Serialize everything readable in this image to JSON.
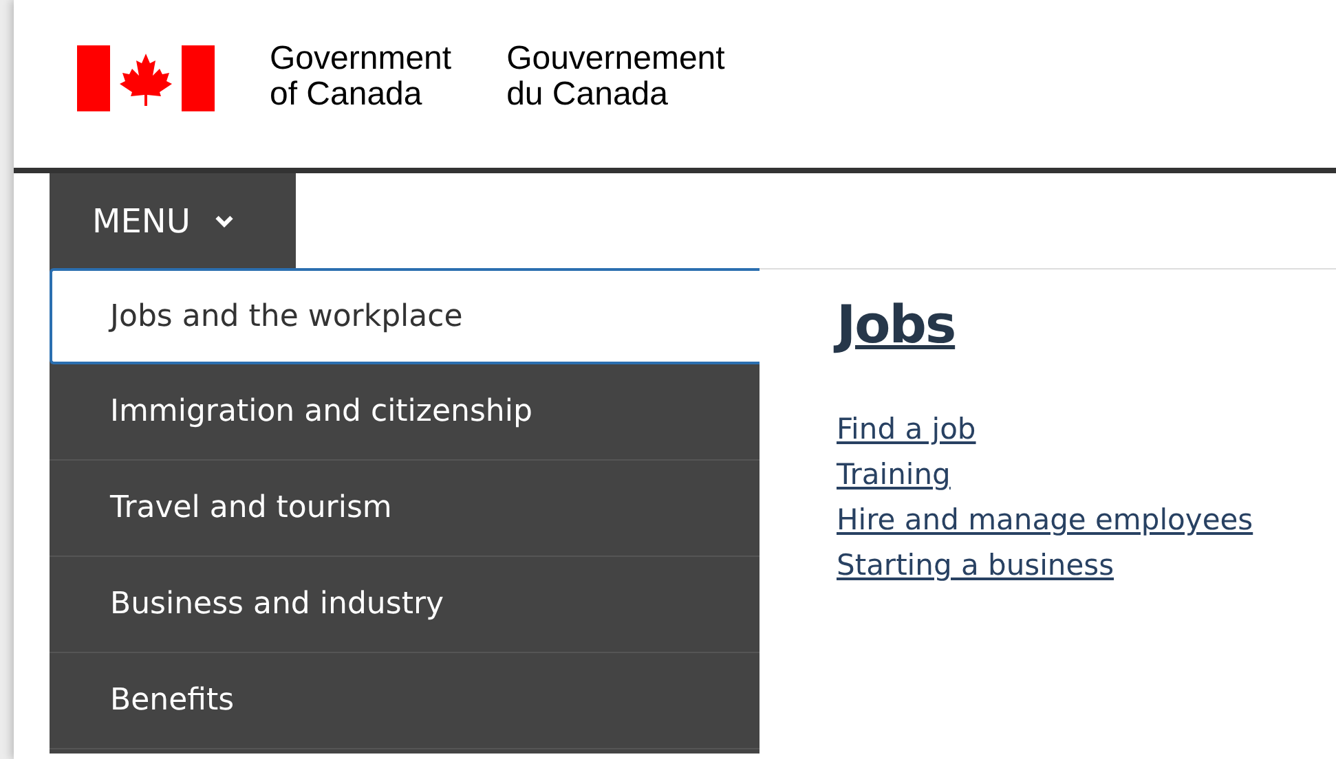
{
  "header": {
    "title_en_line1": "Government",
    "title_en_line2": "of Canada",
    "title_fr_line1": "Gouvernement",
    "title_fr_line2": "du Canada"
  },
  "menu_button": {
    "label": "MENU",
    "expanded": true
  },
  "menu_items": [
    {
      "label": "Jobs and the workplace",
      "selected": true
    },
    {
      "label": "Immigration and citizenship",
      "selected": false
    },
    {
      "label": "Travel and tourism",
      "selected": false
    },
    {
      "label": "Business and industry",
      "selected": false
    },
    {
      "label": "Benefits",
      "selected": false
    }
  ],
  "submenu": {
    "heading": "Jobs",
    "links": [
      "Find a job",
      "Training",
      "Hire and manage employees",
      "Starting a business"
    ]
  }
}
